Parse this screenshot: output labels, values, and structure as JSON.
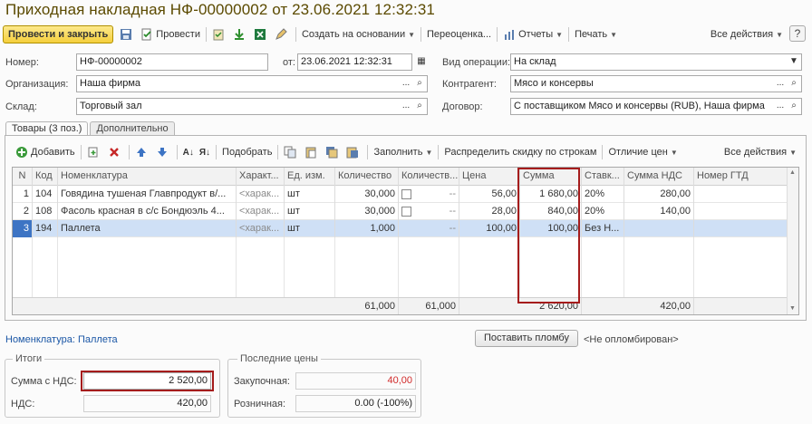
{
  "title": "Приходная накладная НФ-00000002 от 23.06.2021 12:32:31",
  "toolbar": {
    "post_close": "Провести и закрыть",
    "post": "Провести",
    "create_based": "Создать на основании",
    "reprice": "Переоценка...",
    "reports": "Отчеты",
    "print": "Печать",
    "all_actions": "Все действия",
    "help": "?"
  },
  "form": {
    "number_label": "Номер:",
    "number_value": "НФ-00000002",
    "date_label": "от:",
    "date_value": "23.06.2021 12:32:31",
    "operation_label": "Вид операции:",
    "operation_value": "На склад",
    "org_label": "Организация:",
    "org_value": "Наша фирма",
    "contractor_label": "Контрагент:",
    "contractor_value": "Мясо и консервы",
    "warehouse_label": "Склад:",
    "warehouse_value": "Торговый зал",
    "contract_label": "Договор:",
    "contract_value": "С поставщиком Мясо и консервы (RUB), Наша фирма"
  },
  "tabs": [
    "Товары (3 поз.)",
    "Дополнительно"
  ],
  "table_toolbar": {
    "add": "Добавить",
    "pick": "Подобрать",
    "fill": "Заполнить",
    "distribute": "Распределить скидку по строкам",
    "price_diff": "Отличие цен",
    "all_actions": "Все действия"
  },
  "table": {
    "headers": [
      "N",
      "Код",
      "Номенклатура",
      "Характ...",
      "Ед. изм.",
      "Количество",
      "Количеств...",
      "Цена",
      "Сумма",
      "Ставк...",
      "Сумма НДС",
      "Номер ГТД"
    ],
    "rows": [
      {
        "n": "1",
        "code": "104",
        "name": "Говядина тушеная Главпродукт в/...",
        "char": "<харак...",
        "unit": "шт",
        "qty": "30,000",
        "qty2": "--",
        "price": "56,00",
        "sum": "1 680,00",
        "rate": "20%",
        "vat": "280,00",
        "gtd": ""
      },
      {
        "n": "2",
        "code": "108",
        "name": "Фасоль красная в с/с Бондюэль 4...",
        "char": "<харак...",
        "unit": "шт",
        "qty": "30,000",
        "qty2": "--",
        "price": "28,00",
        "sum": "840,00",
        "rate": "20%",
        "vat": "140,00",
        "gtd": ""
      },
      {
        "n": "3",
        "code": "194",
        "name": "Паллета",
        "char": "<харак...",
        "unit": "шт",
        "qty": "1,000",
        "qty2": "--",
        "price": "100,00",
        "sum": "100,00",
        "rate": "Без Н...",
        "vat": "",
        "gtd": ""
      }
    ],
    "totals": {
      "qty": "61,000",
      "qty2": "61,000",
      "sum": "2 620,00",
      "vat": "420,00"
    }
  },
  "bottom": {
    "nomenclature_label": "Номенклатура:",
    "nomenclature_value": "Паллета",
    "seal_button": "Поставить пломбу",
    "seal_status": "<Не опломбирован>"
  },
  "totals_group": {
    "title": "Итоги",
    "sum_vat_label": "Сумма с НДС:",
    "sum_vat_value": "2 520,00",
    "vat_label": "НДС:",
    "vat_value": "420,00"
  },
  "prices_group": {
    "title": "Последние цены",
    "purchase_label": "Закупочная:",
    "purchase_value": "40,00",
    "retail_label": "Розничная:",
    "retail_value": "0.00 (-100%)"
  },
  "colors": {
    "accent_red": "#a51c1c",
    "title": "#5b4a00",
    "selection": "#cfe0f6"
  }
}
